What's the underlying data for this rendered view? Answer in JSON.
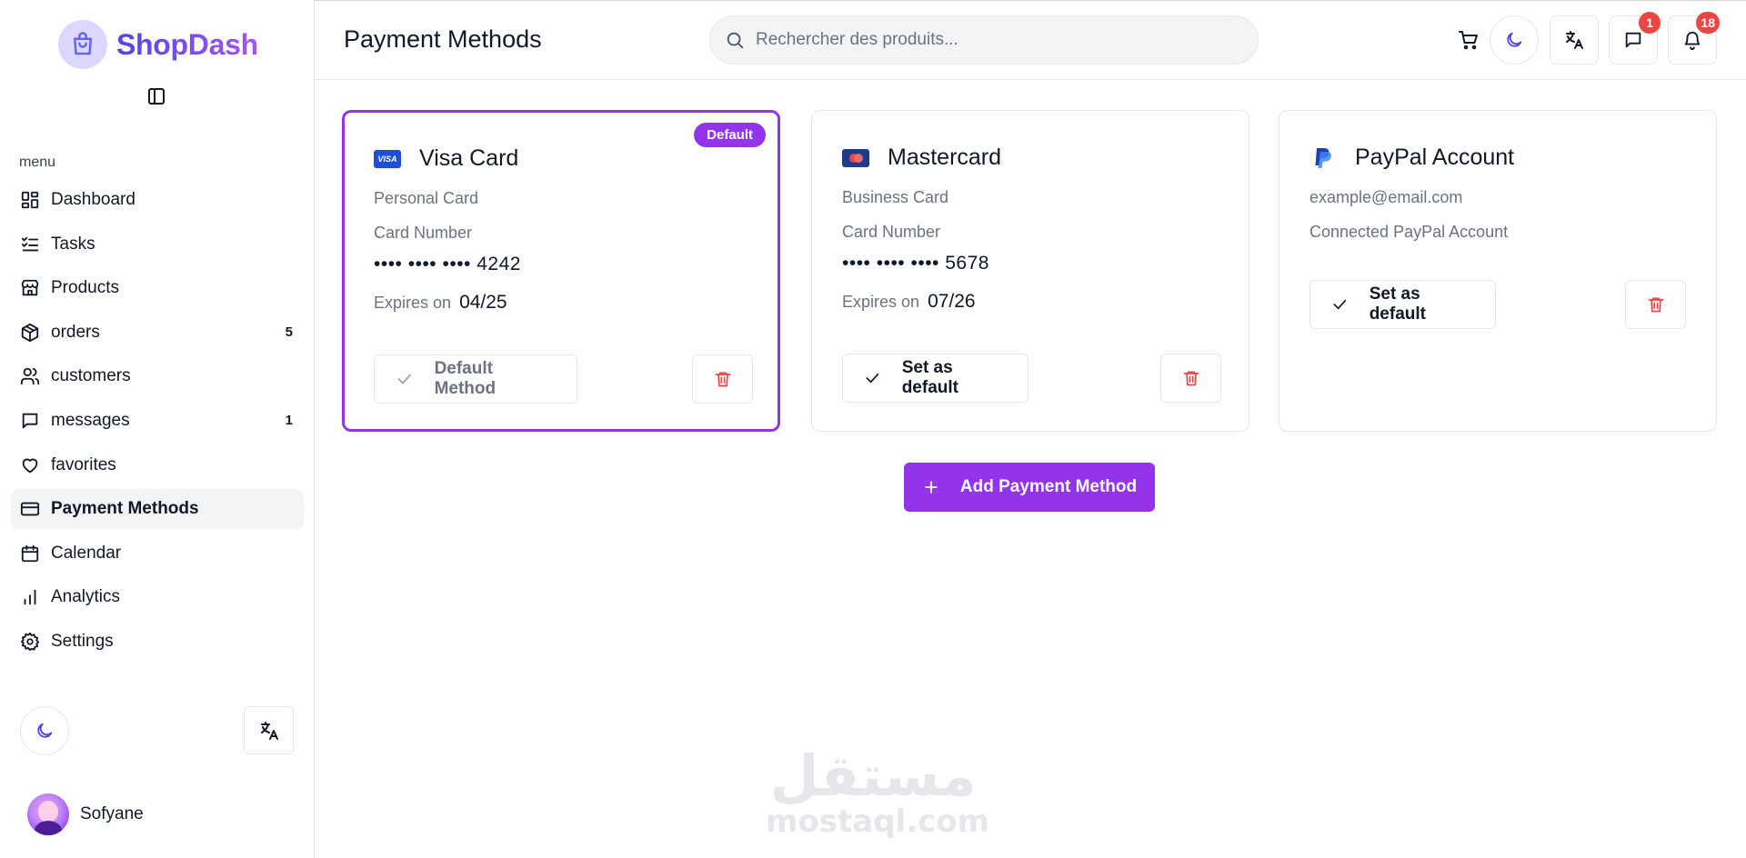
{
  "app": {
    "name": "ShopDash"
  },
  "sidebar": {
    "menu_heading": "menu",
    "items": [
      {
        "label": "Dashboard",
        "icon": "dashboard-icon",
        "badge": ""
      },
      {
        "label": "Tasks",
        "icon": "tasks-icon",
        "badge": ""
      },
      {
        "label": "Products",
        "icon": "store-icon",
        "badge": ""
      },
      {
        "label": "orders",
        "icon": "package-icon",
        "badge": "5"
      },
      {
        "label": "customers",
        "icon": "users-icon",
        "badge": ""
      },
      {
        "label": "messages",
        "icon": "message-icon",
        "badge": "1"
      },
      {
        "label": "favorites",
        "icon": "heart-icon",
        "badge": ""
      },
      {
        "label": "Payment Methods",
        "icon": "credit-card-icon",
        "badge": "",
        "active": true
      },
      {
        "label": "Calendar",
        "icon": "calendar-icon",
        "badge": ""
      },
      {
        "label": "Analytics",
        "icon": "bar-chart-icon",
        "badge": ""
      },
      {
        "label": "Settings",
        "icon": "gear-icon",
        "badge": ""
      }
    ],
    "user": {
      "name": "Sofyane"
    }
  },
  "header": {
    "title": "Payment Methods",
    "search": {
      "placeholder": "Rechercher des produits...",
      "value": ""
    },
    "badges": {
      "messages": "1",
      "notifications": "18"
    }
  },
  "cards": [
    {
      "title": "Visa Card",
      "subtitle": "Personal Card",
      "line2": "Card Number",
      "number": "•••• •••• •••• 4242",
      "expires_label": "Expires on",
      "expires": "04/25",
      "default_badge": "Default",
      "action_label": "Default Method",
      "is_default": true
    },
    {
      "title": "Mastercard",
      "subtitle": "Business Card",
      "line2": "Card Number",
      "number": "•••• •••• •••• 5678",
      "expires_label": "Expires on",
      "expires": "07/26",
      "action_label": "Set as default",
      "is_default": false
    },
    {
      "title": "PayPal Account",
      "subtitle": "example@email.com",
      "line2": "Connected PayPal Account",
      "action_label": "Set as default",
      "is_default": false
    }
  ],
  "add_button": {
    "label": "Add Payment Method"
  },
  "watermark": {
    "arabic": "مستقل",
    "latin": "mostaql.com"
  },
  "colors": {
    "accent": "#9333ea",
    "brand_start": "#4f46e5",
    "brand_end": "#a855f7",
    "danger": "#ef4444"
  }
}
